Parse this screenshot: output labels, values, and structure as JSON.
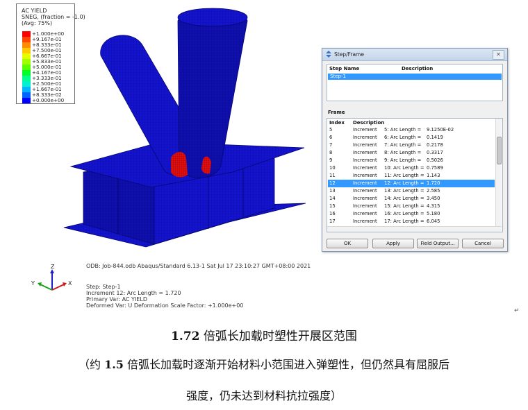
{
  "legend": {
    "title": "AC YIELD",
    "line2": "SNEG, (fraction = -1.0)",
    "line3": "(Avg: 75%)",
    "entries": [
      {
        "label": "+1.000e+00",
        "color": "#ff0000"
      },
      {
        "label": "+9.167e-01",
        "color": "#ff4600"
      },
      {
        "label": "+8.333e-01",
        "color": "#ff8c00"
      },
      {
        "label": "+7.500e-01",
        "color": "#ffc800"
      },
      {
        "label": "+6.667e-01",
        "color": "#e6ff00"
      },
      {
        "label": "+5.833e-01",
        "color": "#a0ff00"
      },
      {
        "label": "+5.000e-01",
        "color": "#5aff00"
      },
      {
        "label": "+4.167e-01",
        "color": "#00ff28"
      },
      {
        "label": "+3.333e-01",
        "color": "#00ff8c"
      },
      {
        "label": "+2.500e-01",
        "color": "#00f0d2"
      },
      {
        "label": "+1.667e-01",
        "color": "#00b4ff"
      },
      {
        "label": "+8.333e-02",
        "color": "#0064ff"
      },
      {
        "label": "+0.000e+00",
        "color": "#0000ff"
      }
    ]
  },
  "info": {
    "odb_line": "ODB: Job-844.odb    Abaqus/Standard 6.13-1    Sat Jul 17 23:10:27 GMT+08:00 2021",
    "step_line": "Step: Step-1",
    "increment_line": "Increment     12: Arc Length =     1.720",
    "primary_line": "Primary Var: AC YIELD",
    "deformed_line": "Deformed Var: U   Deformation Scale Factor: +1.000e+00"
  },
  "triad": {
    "x": "X",
    "y": "Y",
    "z": "Z"
  },
  "dialog": {
    "title": "Step/Frame",
    "close_symbol": "✕",
    "step_header_name": "Step Name",
    "step_header_desc": "Description",
    "selected_step": "Step-1",
    "frame_label": "Frame",
    "frame_header_index": "Index",
    "frame_header_desc": "Description",
    "frames": [
      {
        "index": "5",
        "type": "Increment",
        "desc": "5: Arc Length =",
        "value": "9.1250E-02"
      },
      {
        "index": "6",
        "type": "Increment",
        "desc": "6: Arc Length =",
        "value": "0.1419"
      },
      {
        "index": "7",
        "type": "Increment",
        "desc": "7: Arc Length =",
        "value": "0.2178"
      },
      {
        "index": "8",
        "type": "Increment",
        "desc": "8: Arc Length =",
        "value": "0.3317"
      },
      {
        "index": "9",
        "type": "Increment",
        "desc": "9: Arc Length =",
        "value": "0.5026"
      },
      {
        "index": "10",
        "type": "Increment",
        "desc": "10: Arc Length =",
        "value": "0.7589"
      },
      {
        "index": "11",
        "type": "Increment",
        "desc": "11: Arc Length =",
        "value": "1.143"
      },
      {
        "index": "12",
        "type": "Increment",
        "desc": "12: Arc Length =",
        "value": "1.720"
      },
      {
        "index": "13",
        "type": "Increment",
        "desc": "13: Arc Length =",
        "value": "2.585"
      },
      {
        "index": "14",
        "type": "Increment",
        "desc": "14: Arc Length =",
        "value": "3.450"
      },
      {
        "index": "15",
        "type": "Increment",
        "desc": "15: Arc Length =",
        "value": "4.315"
      },
      {
        "index": "16",
        "type": "Increment",
        "desc": "16: Arc Length =",
        "value": "5.180"
      },
      {
        "index": "17",
        "type": "Increment",
        "desc": "17: Arc Length =",
        "value": "6.045"
      }
    ],
    "selected_frame_index": "12",
    "buttons": {
      "ok": "OK",
      "apply": "Apply",
      "field_output": "Field Output...",
      "cancel": "Cancel"
    }
  },
  "caption": {
    "line1_num": "1.72",
    "line1_text": " 倍弧长加载时塑性开展区范围",
    "line2_pre": "（约 ",
    "line2_num": "1.5",
    "line2_text": " 倍弧长加载时逐渐开始材料小范围进入弹塑性，但仍然具有屈服后",
    "line3": "强度，仍未达到材料抗拉强度）"
  },
  "colors": {
    "mesh_blue": "#1616d8",
    "mesh_dark": "#0a0a8a",
    "yield_red": "#e01010",
    "selection": "#3399ff"
  }
}
